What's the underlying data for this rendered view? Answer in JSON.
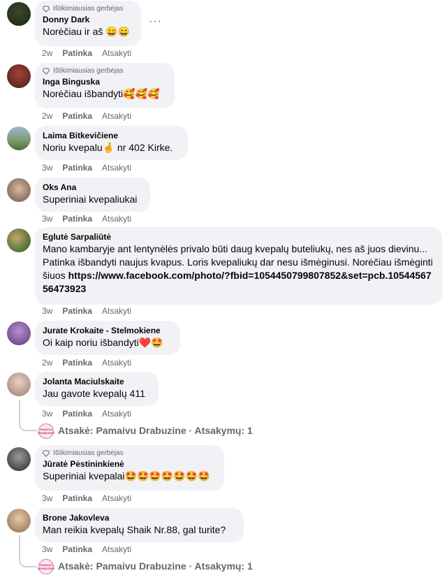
{
  "badge_label": "Ištikimiausias gerbėjas",
  "more_label": "···",
  "comments": [
    {
      "author": "Donny Dark",
      "text": "Norėčiau ir aš 😄😄",
      "time": "2w",
      "like": "Patinka",
      "reply": "Atsakyti"
    },
    {
      "author": "Inga Binguska",
      "text": "Norėčiau išbandyti🥰🥰🥰",
      "time": "2w",
      "like": "Patinka",
      "reply": "Atsakyti"
    },
    {
      "author": "Laima Bitkevičiene",
      "text": "Noriu kvepalu🤞 nr 402 Kirke.",
      "time": "3w",
      "like": "Patinka",
      "reply": "Atsakyti"
    },
    {
      "author": "Oks Ana",
      "text": "Superiniai kvepaliukai",
      "time": "3w",
      "like": "Patinka",
      "reply": "Atsakyti"
    },
    {
      "author": "Eglutė Sarpaliūtė",
      "text": "Mano kambaryje ant lentynėlės privalo būti daug kvepalų buteliukų, nes aš juos dievinu... Patinka išbandyti naujus kvapus. Loris kvepaliukų dar nesu išmėginusi. Norėčiau išmėginti šiuos",
      "link": "https://www.facebook.com/photo/?fbid=1054450799807852&set=pcb.1054456756473923",
      "time": "3w",
      "like": "Patinka",
      "reply": "Atsakyti"
    },
    {
      "author": "Jurate Krokaite - Stelmokiene",
      "text": "Oi kaip noriu išbandyti❤️🤩",
      "time": "2w",
      "like": "Patinka",
      "reply": "Atsakyti"
    },
    {
      "author": "Jolanta Maciulskaite",
      "text": "Jau gavote kvepalų 411",
      "time": "3w",
      "like": "Patinka",
      "reply": "Atsakyti",
      "replies_text": "Atsakė: Pamaivu Drabuzine · Atsakymų: 1"
    },
    {
      "author": "Jūratė Pėstininkienė",
      "text": "Superiniai kvepalai🤩🤩🤩🤩🤩🤩🤩",
      "time": "3w",
      "like": "Patinka",
      "reply": "Atsakyti"
    },
    {
      "author": "Brone Jakovleva",
      "text": "Man reikia kvepalų Shaik Nr.88, gal turite?",
      "time": "3w",
      "like": "Patinka",
      "reply": "Atsakyti",
      "replies_text": "Atsakė: Pamaivu Drabuzine · Atsakymų: 1"
    }
  ],
  "reply_avatar_text": "PAMAIVU DRABUZINE"
}
